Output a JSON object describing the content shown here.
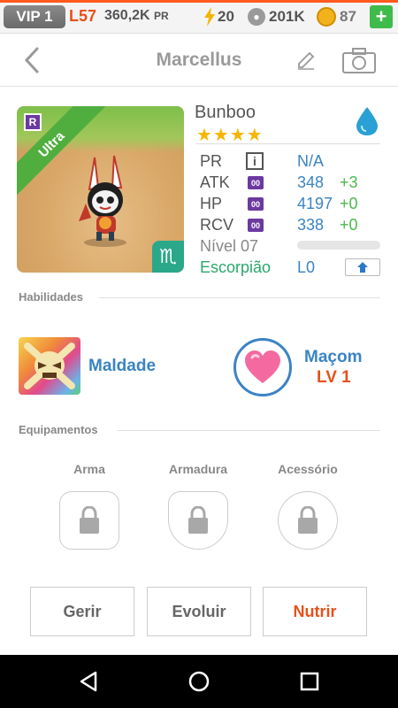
{
  "status": {
    "vip": "VIP 1",
    "level": "L57",
    "pr": "360,2K",
    "pr_unit": "PR",
    "energy": "20",
    "paw": "201K",
    "coins": "87",
    "plus": "+"
  },
  "header": {
    "title": "Marcellus"
  },
  "pet": {
    "name": "Bunboo",
    "rarity_letter": "R",
    "rarity_ribbon": "Ultra",
    "zodiac_symbol": "♏",
    "stars": "★★★★",
    "stats": [
      {
        "label": "PR",
        "badge": "i",
        "value": "N/A",
        "bonus": ""
      },
      {
        "label": "ATK",
        "badge": "00",
        "value": "348",
        "bonus": "+3"
      },
      {
        "label": "HP",
        "badge": "00",
        "value": "4197",
        "bonus": "+0"
      },
      {
        "label": "RCV",
        "badge": "00",
        "value": "338",
        "bonus": "+0"
      }
    ],
    "level_label": "Nível 07",
    "level_progress": 0.0,
    "zodiac_label": "Escorpião",
    "zodiac_level": "L0"
  },
  "skills": {
    "title": "Habilidades",
    "active_name": "Maldade",
    "leader_name": "Maçom",
    "leader_level": "LV 1"
  },
  "equipment": {
    "title": "Equipamentos",
    "slots": [
      "Arma",
      "Armadura",
      "Acessório"
    ]
  },
  "actions": {
    "manage": "Gerir",
    "evolve": "Evoluir",
    "feed": "Nutrir"
  },
  "colors": {
    "accent_blue": "#3a84c4",
    "accent_orange": "#e8501a",
    "accent_green": "#4bb84b"
  }
}
